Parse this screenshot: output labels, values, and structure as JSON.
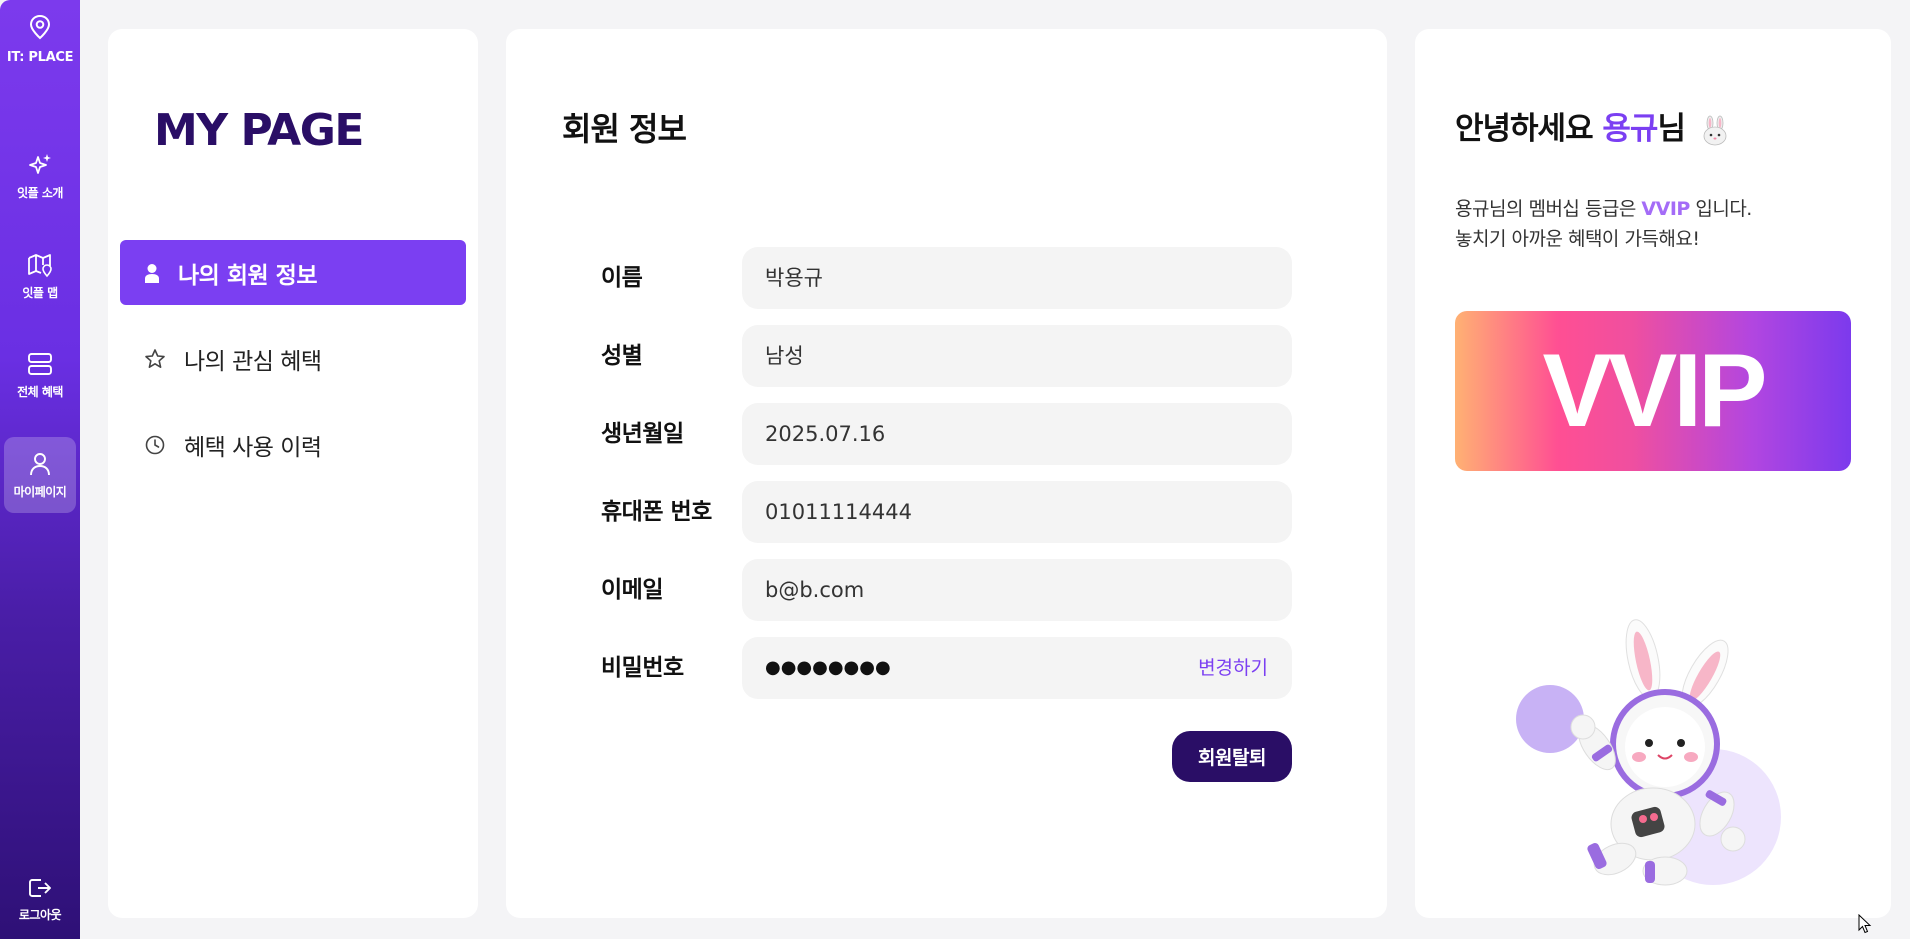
{
  "sidebar": {
    "logo": "IT: PLACE",
    "items": [
      {
        "label": "잇플 소개",
        "icon": "sparkles-icon"
      },
      {
        "label": "잇플 맵",
        "icon": "map-icon"
      },
      {
        "label": "전체 혜택",
        "icon": "list-icon"
      },
      {
        "label": "마이페이지",
        "icon": "user-icon",
        "active": true
      }
    ],
    "logout": "로그아웃"
  },
  "menu": {
    "title": "MY PAGE",
    "items": [
      {
        "label": "나의 회원 정보",
        "icon": "person-icon",
        "active": true
      },
      {
        "label": "나의 관심 혜택",
        "icon": "star-icon"
      },
      {
        "label": "혜택 사용 이력",
        "icon": "clock-icon"
      }
    ]
  },
  "profile": {
    "title": "회원 정보",
    "fields": [
      {
        "label": "이름",
        "value": "박용규"
      },
      {
        "label": "성별",
        "value": "남성"
      },
      {
        "label": "생년월일",
        "value": "2025.07.16"
      },
      {
        "label": "휴대폰 번호",
        "value": "01011114444"
      },
      {
        "label": "이메일",
        "value": "b@b.com"
      },
      {
        "label": "비밀번호",
        "value": "●●●●●●●●"
      }
    ],
    "change_label": "변경하기",
    "withdraw_label": "회원탈퇴"
  },
  "welcome": {
    "greeting_prefix": "안녕하세요 ",
    "name": "용규",
    "greeting_suffix": "님",
    "line1_prefix": "용규님의 멤버십 등급은 ",
    "tier": "VVIP",
    "line1_suffix": " 입니다.",
    "line2": "놓치기 아까운 혜택이 가득해요!",
    "tier_badge": "VVIP"
  },
  "colors": {
    "accent": "#7b3ff2",
    "dark": "#2a0e66",
    "tier_light": "#a46cf7"
  }
}
